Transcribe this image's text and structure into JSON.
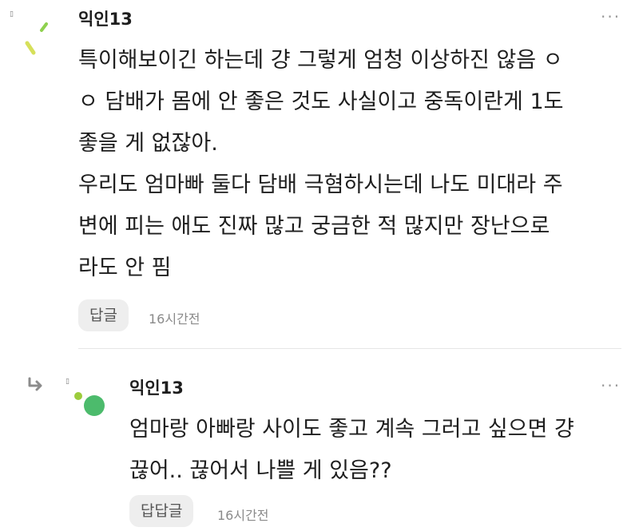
{
  "comments": [
    {
      "author": "익인13",
      "body_lines": [
        "특이해보이긴 하는데 걍 그렇게 엄청 이상하진 않음 ㅇ",
        "ㅇ 담배가 몸에 안 좋은 것도 사실이고 중독이란게 1도",
        "좋을 게 없잖아.",
        "우리도 엄마빠 둘다 담배 극혐하시는데 나도 미대라 주",
        "변에 피는 애도 진짜 많고 궁금한 적 많지만 장난으로",
        "라도 안 핌"
      ],
      "reply_label": "답글",
      "time": "16시간전",
      "more_label": "···"
    },
    {
      "author": "익인13",
      "body_lines": [
        "엄마랑 아빠랑 사이도 좋고 계속 그러고 싶으면 걍",
        "끊어.. 끊어서 나쁠 게 있음??"
      ],
      "reply_label": "답답글",
      "time": "16시간전",
      "more_label": "···"
    }
  ],
  "colors": {
    "avatar1_accent_green": "#8fd14f",
    "avatar1_accent_yellow": "#d6e05a",
    "avatar2_main_green": "#4cbb6c",
    "avatar2_dot_green": "#9ccc3c",
    "reply_arrow": "#8c8c8c"
  },
  "icons": {
    "reply_indicator": "reply-arrow-icon"
  }
}
